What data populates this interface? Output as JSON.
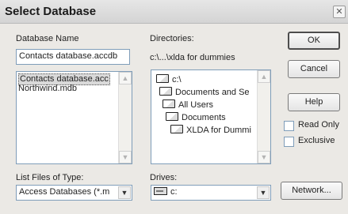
{
  "dialog": {
    "title": "Select Database",
    "close_glyph": "✕"
  },
  "database_name": {
    "label": "Database Name",
    "value": "Contacts database.accdb",
    "files": [
      "Contacts database.acc",
      "Northwind.mdb"
    ]
  },
  "directories": {
    "label": "Directories:",
    "current_path": "c:\\...\\xlda for dummies",
    "tree": [
      "c:\\",
      "Documents and Se",
      "All Users",
      "Documents",
      "XLDA for Dummi"
    ]
  },
  "file_type": {
    "label": "List Files of Type:",
    "value": "Access Databases (*.m"
  },
  "drives": {
    "label": "Drives:",
    "value": "c:"
  },
  "buttons": {
    "ok": "OK",
    "cancel": "Cancel",
    "help": "Help",
    "network": "Network..."
  },
  "options": {
    "read_only": "Read Only",
    "exclusive": "Exclusive"
  },
  "icons": {
    "folder": "folder-icon",
    "drive": "drive-icon"
  }
}
